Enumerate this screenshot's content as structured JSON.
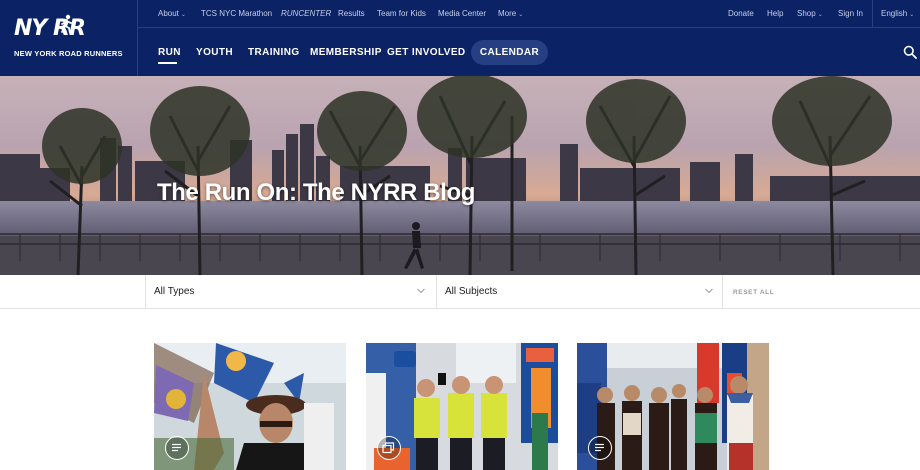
{
  "brand": {
    "logo_text": "NY RR",
    "logo_subtitle": "NEW YORK ROAD RUNNERS",
    "primary_color": "#0b2265"
  },
  "utility_nav": {
    "left": [
      {
        "label": "About",
        "has_dropdown": true
      },
      {
        "label": "TCS NYC Marathon",
        "has_dropdown": false
      },
      {
        "label": "RUNCENTER",
        "has_dropdown": false
      },
      {
        "label": "Results",
        "has_dropdown": false
      },
      {
        "label": "Team for Kids",
        "has_dropdown": false
      },
      {
        "label": "Media Center",
        "has_dropdown": false
      },
      {
        "label": "More",
        "has_dropdown": true
      }
    ],
    "right": [
      {
        "label": "Donate",
        "has_dropdown": false
      },
      {
        "label": "Help",
        "has_dropdown": false
      },
      {
        "label": "Shop",
        "has_dropdown": true
      },
      {
        "label": "Sign In",
        "has_dropdown": false
      },
      {
        "label": "English",
        "has_dropdown": true
      }
    ]
  },
  "main_nav": {
    "items": [
      {
        "label": "RUN",
        "active": true
      },
      {
        "label": "YOUTH",
        "active": false
      },
      {
        "label": "TRAINING",
        "active": false
      },
      {
        "label": "MEMBERSHIP",
        "active": false
      },
      {
        "label": "GET INVOLVED",
        "active": false
      }
    ],
    "calendar_label": "CALENDAR",
    "search_icon": "search-icon"
  },
  "hero": {
    "title": "The Run On: The NYRR Blog"
  },
  "filters": {
    "types": {
      "value": "All Types"
    },
    "subjects": {
      "value": "All Subjects"
    },
    "reset_label": "RESET ALL"
  },
  "cards": [
    {
      "badge_icon": "article-icon"
    },
    {
      "badge_icon": "gallery-icon"
    },
    {
      "badge_icon": "article-icon"
    }
  ]
}
